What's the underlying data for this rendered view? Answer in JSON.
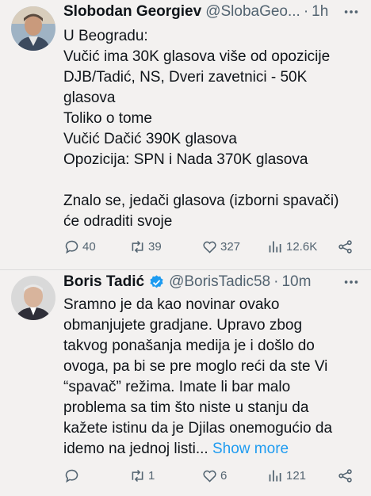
{
  "tweets": [
    {
      "author_name": "Slobodan Georgiev",
      "handle": "@SlobaGeo...",
      "separator": "·",
      "time": "1h",
      "lines": [
        "U Beogradu:",
        "Vučić ima 30K glasova više od opozicije",
        "DJB/Tadić, NS, Dveri zavetnici - 50K",
        "glasova",
        "Toliko o tome",
        "Vučić Dačić 390K glasova",
        "Opozicija: SPN i Nada 370K glasova",
        "",
        "Znalo se, jedači glasova (izborni spavači)",
        "će odraditi svoje"
      ],
      "replies": "40",
      "retweets": "39",
      "likes": "327",
      "views": "12.6K"
    },
    {
      "author_name": "Boris Tadić",
      "handle": "@BorisTadic58",
      "separator": "·",
      "time": "10m",
      "lines": [
        "Sramno je da kao novinar ovako",
        "obmanjujete gradjane. Upravo zbog",
        "takvog ponašanja medija je i došlo do",
        "ovoga, pa bi se pre moglo reći da ste Vi",
        "“spavač” režima. Imate li bar malo",
        "problema sa tim što niste u stanju da",
        "kažete istinu da je Djilas onemogućio da",
        "idemo na jednoj listi..."
      ],
      "show_more": "Show more",
      "replies": "",
      "retweets": "1",
      "likes": "6",
      "views": "121"
    }
  ],
  "colors": {
    "accent": "#1d9bf0",
    "muted": "#536471",
    "text": "#0f1419",
    "background": "#f3f1f0"
  }
}
